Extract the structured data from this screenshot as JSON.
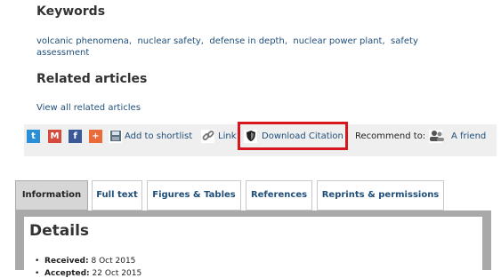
{
  "article": {
    "keywords_heading": "Keywords",
    "keywords": [
      "volcanic phenomena,",
      "nuclear safety,",
      "defense in depth,",
      "nuclear power plant,",
      "safety",
      "assessment"
    ],
    "related_heading": "Related articles",
    "related_link": "View all related articles"
  },
  "toolbar": {
    "twitter_icon": "twitter-icon",
    "gmail_icon": "gmail-icon",
    "facebook_icon": "facebook-icon",
    "plus_icon": "plus-icon",
    "shortlist_label": "Add to shortlist",
    "link_label": "Link",
    "download_citation_label": "Download Citation",
    "recommend_label": "Recommend to:",
    "friend_label": "A friend",
    "highlight_color": "#d8161e"
  },
  "tabs": [
    {
      "label": "Information",
      "active": true
    },
    {
      "label": "Full text",
      "active": false
    },
    {
      "label": "Figures & Tables",
      "active": false
    },
    {
      "label": "References",
      "active": false
    },
    {
      "label": "Reprints & permissions",
      "active": false
    }
  ],
  "details": {
    "title": "Details",
    "received_label": "Received:",
    "received_value": "8 Oct 2015",
    "accepted_label": "Accepted:",
    "accepted_value": "22 Oct 2015"
  }
}
